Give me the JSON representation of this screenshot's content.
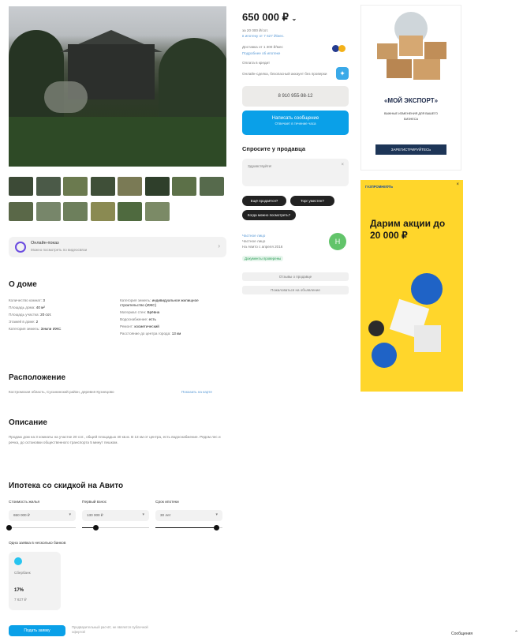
{
  "listing": {
    "thumbnails": [
      {
        "color": "#3c4a36"
      },
      {
        "color": "#4b5a48"
      },
      {
        "color": "#6b7a4f"
      },
      {
        "color": "#3f4f38"
      },
      {
        "color": "#7a7a55"
      },
      {
        "color": "#2f3f2b"
      },
      {
        "color": "#5c7048"
      },
      {
        "color": "#566a4c"
      },
      {
        "color": "#5a6848"
      },
      {
        "color": "#77866a"
      },
      {
        "color": "#6d7f5c"
      },
      {
        "color": "#8a8a52"
      },
      {
        "color": "#4f6a3f"
      },
      {
        "color": "#7b8a66"
      }
    ],
    "online_banner": {
      "title": "Онлайн-показ",
      "subtitle": "Можно посмотреть по видеосвязи"
    }
  },
  "about_house": {
    "heading": "О доме",
    "left": [
      {
        "label": "Количество комнат:",
        "value": "3"
      },
      {
        "label": "Площадь дома:",
        "value": "40 м²"
      },
      {
        "label": "Площадь участка:",
        "value": "20 сот."
      },
      {
        "label": "Этажей в доме:",
        "value": "2"
      },
      {
        "label": "Категория земель:",
        "value": "Земли ИЖС"
      }
    ],
    "right": [
      {
        "label": "Категория земель:",
        "value": "индивидуальное жилищное строительство (ИЖС)"
      },
      {
        "label": "Материал стен:",
        "value": "Брёвна"
      },
      {
        "label": "Водоснабжение:",
        "value": "есть"
      },
      {
        "label": "Ремонт:",
        "value": "косметический"
      },
      {
        "label": "Расстояние до центра города:",
        "value": "13 км"
      }
    ]
  },
  "location": {
    "heading": "Расположение",
    "address": "Костромская область, Сусанинский район, деревня Кузнецово",
    "map_link": "Показать на карте"
  },
  "description": {
    "heading": "Описание",
    "text": "Продаю дом на 3 комнаты на участке 20 сот., общей площадью 40 кв.м. В 13 км от центра, есть водоснабжение. Рядом лес и речка, до остановки общественного транспорта 5 минут пешком."
  },
  "mortgage": {
    "heading": "Ипотека со скидкой на Авито",
    "fields": [
      {
        "label": "Стоимость жилья",
        "value": "650 000 ₽",
        "fill": 0.0
      },
      {
        "label": "Первый взнос",
        "value": "130 000 ₽",
        "fill": 0.2
      },
      {
        "label": "Срок ипотеки",
        "value": "30 лет",
        "fill": 0.9
      }
    ],
    "banks_label": "Одна заявка в несколько банков",
    "bank": {
      "name": "Сбербанк",
      "rate": "17%",
      "payment": "7 627 ₽"
    },
    "submit_label": "Подать заявку",
    "disclaimer": "Предварительный расчёт, не является публичной офертой"
  },
  "sidebar": {
    "price": "650 000 ₽",
    "price_note": "за 20 000 ₽/сот.",
    "mortgage_note": "в ипотеку от 7 627 ₽/мес.",
    "delivery_note": "Доставка от 1 300 ₽/мес",
    "delivery_link": "Подробнее об ипотеке",
    "payment_note": "Оплата в кредит",
    "safe_deal": "Онлайн-сделка, безопасный аккаунт без проверки ",
    "phone": "8 910 955-98-12",
    "message_btn_title": "Написать сообщение",
    "message_btn_sub": "Отвечает в течение часа",
    "ask_heading": "Спросите у продавца",
    "ask_placeholder": "Здравствуйте!",
    "chips": [
      "Ещё продаётся?",
      "Торг уместен?",
      "Когда можно посмотреть?"
    ],
    "seller": {
      "type": "Частное лицо",
      "name": "Частное лицо",
      "since": "На Авито с апреля 2016",
      "docs": "Документы проверены",
      "avatar_letter": "Н"
    },
    "buttons": [
      "Отзывы о продавце",
      "Пожаловаться на объявление"
    ]
  },
  "ads": {
    "ad1": {
      "title": "«МОЙ ЭКСПОРТ»",
      "line1": "ВАЖНЫЕ ИЗМЕНЕНИЯ ДЛЯ ВАШЕГО",
      "line2": "БИЗНЕСА",
      "cta": "ЗАРЕГИСТРИРУЙТЕСЬ"
    },
    "ad2": {
      "brand": "ГАЗПРОМНЕФТЬ",
      "headline": "Дарим акции до 20 000 ₽"
    }
  },
  "footer": {
    "messages": "Сообщения"
  }
}
